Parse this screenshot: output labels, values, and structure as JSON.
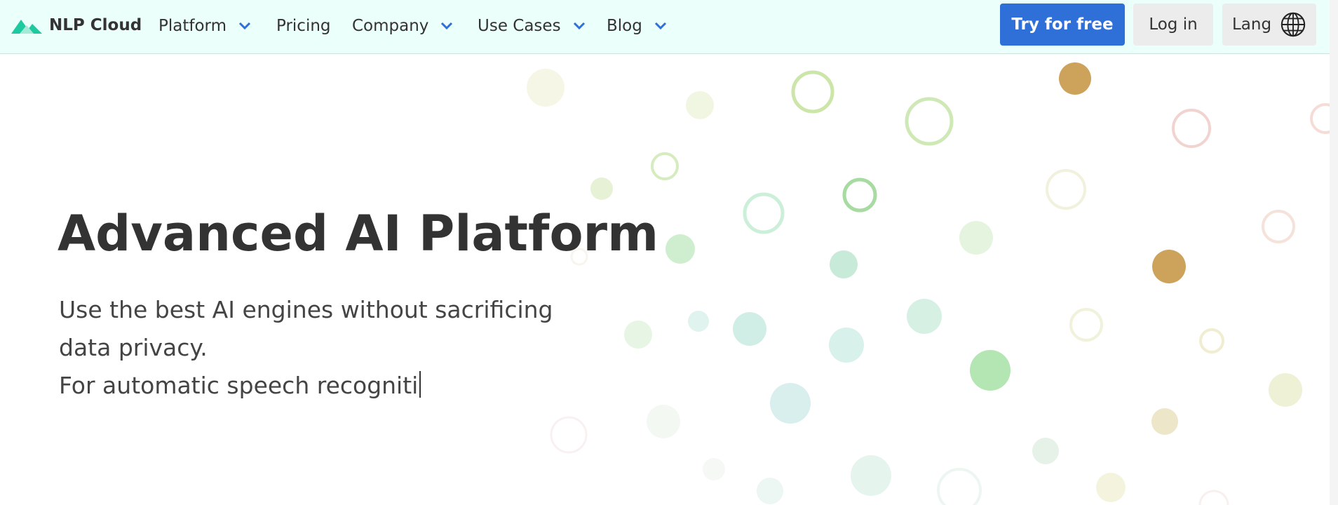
{
  "navbar": {
    "brand": "NLP Cloud",
    "items": [
      {
        "label": "Platform",
        "dropdown": true
      },
      {
        "label": "Pricing",
        "dropdown": false
      },
      {
        "label": "Company",
        "dropdown": true
      },
      {
        "label": "Use Cases",
        "dropdown": true
      },
      {
        "label": "Blog",
        "dropdown": true
      }
    ],
    "try_label": "Try for free",
    "login_label": "Log in",
    "lang_label": "Lang"
  },
  "hero": {
    "title": "Advanced AI Platform",
    "subtitle": "Use the best AI engines without sacrificing data privacy.",
    "typed_text": "For automatic speech recogniti"
  },
  "colors": {
    "accent": "#2e6fd8",
    "navbar_bg": "#ebfffb",
    "brand_logo": "#1fc9a0"
  }
}
